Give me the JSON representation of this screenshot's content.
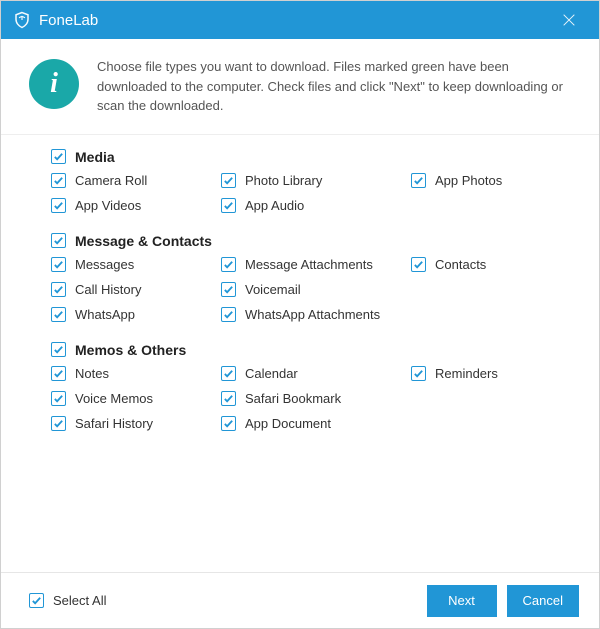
{
  "app_title": "FoneLab",
  "description": "Choose file types you want to download. Files marked green have been downloaded to the computer. Check files and click \"Next\" to keep downloading or scan the downloaded.",
  "accent_color": "#2196d6",
  "info_icon_color": "#1aa8a8",
  "groups": [
    {
      "name": "Media",
      "checked": true,
      "items": [
        {
          "label": "Camera Roll",
          "checked": true
        },
        {
          "label": "Photo Library",
          "checked": true
        },
        {
          "label": "App Photos",
          "checked": true
        },
        {
          "label": "App Videos",
          "checked": true
        },
        {
          "label": "App Audio",
          "checked": true
        }
      ]
    },
    {
      "name": "Message & Contacts",
      "checked": true,
      "items": [
        {
          "label": "Messages",
          "checked": true
        },
        {
          "label": "Message Attachments",
          "checked": true
        },
        {
          "label": "Contacts",
          "checked": true
        },
        {
          "label": "Call History",
          "checked": true
        },
        {
          "label": "Voicemail",
          "checked": true
        },
        {
          "label": "",
          "checked": false
        },
        {
          "label": "WhatsApp",
          "checked": true
        },
        {
          "label": "WhatsApp Attachments",
          "checked": true
        }
      ]
    },
    {
      "name": "Memos & Others",
      "checked": true,
      "items": [
        {
          "label": "Notes",
          "checked": true
        },
        {
          "label": "Calendar",
          "checked": true
        },
        {
          "label": "Reminders",
          "checked": true
        },
        {
          "label": "Voice Memos",
          "checked": true
        },
        {
          "label": "Safari Bookmark",
          "checked": true
        },
        {
          "label": "",
          "checked": false
        },
        {
          "label": "Safari History",
          "checked": true
        },
        {
          "label": "App Document",
          "checked": true
        }
      ]
    }
  ],
  "footer": {
    "select_all_label": "Select All",
    "select_all_checked": true,
    "next_label": "Next",
    "cancel_label": "Cancel"
  }
}
